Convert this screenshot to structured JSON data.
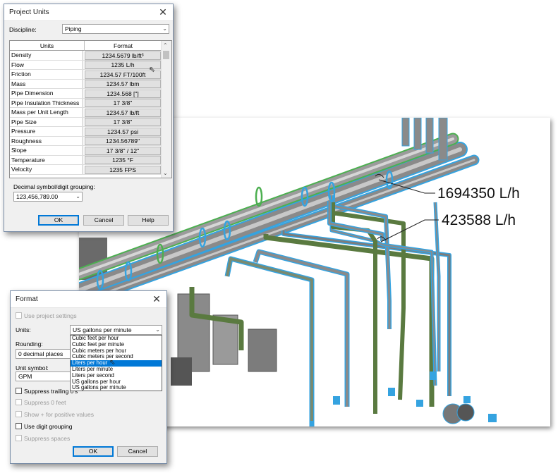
{
  "viewport": {
    "tag_upper": "1694350 L/h",
    "tag_lower": "423588 L/h"
  },
  "project_units": {
    "title": "Project Units",
    "discipline_label": "Discipline:",
    "discipline_value": "Piping",
    "columns": [
      "Units",
      "Format"
    ],
    "rows": [
      {
        "unit": "Density",
        "format": "1234.5679 lb/ft³"
      },
      {
        "unit": "Flow",
        "format": "1235 L/h"
      },
      {
        "unit": "Friction",
        "format": "1234.57 FT/100ft"
      },
      {
        "unit": "Mass",
        "format": "1234.57 lbm"
      },
      {
        "unit": "Pipe Dimension",
        "format": "1234.568 [\"]"
      },
      {
        "unit": "Pipe Insulation Thickness",
        "format": "17 3/8\""
      },
      {
        "unit": "Mass per Unit Length",
        "format": "1234.57 lb/ft"
      },
      {
        "unit": "Pipe Size",
        "format": "17 3/8\""
      },
      {
        "unit": "Pressure",
        "format": "1234.57 psi"
      },
      {
        "unit": "Roughness",
        "format": "1234.56789\""
      },
      {
        "unit": "Slope",
        "format": "17 3/8\" / 12\""
      },
      {
        "unit": "Temperature",
        "format": "1235 °F"
      },
      {
        "unit": "Velocity",
        "format": "1235 FPS"
      }
    ],
    "decimal_label": "Decimal symbol/digit grouping:",
    "decimal_value": "123,456,789.00",
    "ok": "OK",
    "cancel": "Cancel",
    "help": "Help"
  },
  "format": {
    "title": "Format",
    "use_project_settings": "Use project settings",
    "units_label": "Units:",
    "units_value": "US gallons per minute",
    "units_options": [
      "Cubic feet per hour",
      "Cubic feet per minute",
      "Cubic meters per hour",
      "Cubic meters per second",
      "Liters per hour",
      "Liters per minute",
      "Liters per second",
      "US gallons per hour",
      "US gallons per minute"
    ],
    "units_selected_index": 4,
    "rounding_label": "Rounding:",
    "rounding_value": "0 decimal places",
    "unit_symbol_label": "Unit symbol:",
    "unit_symbol_value": "GPM",
    "suppress_trailing": "Suppress trailing 0's",
    "suppress_zero_feet": "Suppress 0 feet",
    "show_plus": "Show + for positive values",
    "use_digit_grouping": "Use digit grouping",
    "suppress_spaces": "Suppress spaces",
    "ok": "OK",
    "cancel": "Cancel"
  },
  "colors": {
    "accent": "#0078d7",
    "pipe_grey": "#8e8e8e",
    "pipe_green": "#5a7a40",
    "pipe_blue_outline": "#35a3e0"
  },
  "icons": [
    "close-icon",
    "chevron-down-icon",
    "scroll-up-icon",
    "scroll-down-icon",
    "mouse-cursor-icon"
  ]
}
